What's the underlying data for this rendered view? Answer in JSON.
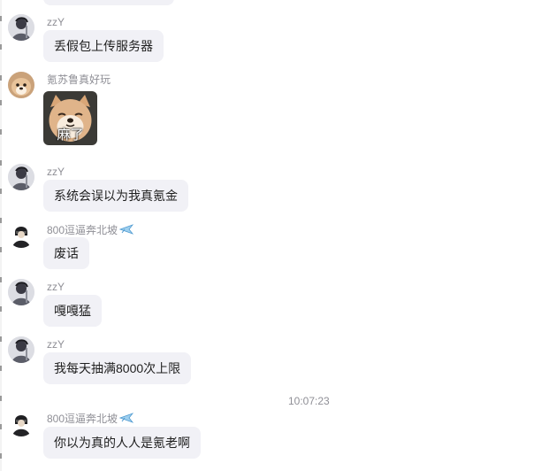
{
  "chat": {
    "messages": [
      {
        "id": "m1",
        "sender": "zzY",
        "avatar": "ink-painting-avatar",
        "text": "丢假包上传服务器"
      },
      {
        "id": "m2",
        "sender": "氪苏鲁真好玩",
        "avatar": "dog-avatar",
        "sticker": {
          "caption": "麻了",
          "icon": "shiba-dog-sticker"
        }
      },
      {
        "id": "m3",
        "sender": "zzY",
        "avatar": "ink-painting-avatar",
        "text": "系统会误以为我真氪金"
      },
      {
        "id": "m4",
        "sender": "800逗逼奔北坡",
        "sender_icon": "airplane-icon",
        "avatar": "dark-figure-avatar",
        "text": "废话"
      },
      {
        "id": "m5",
        "sender": "zzY",
        "avatar": "ink-painting-avatar",
        "text": "嘎嘎猛"
      },
      {
        "id": "m6",
        "sender": "zzY",
        "avatar": "ink-painting-avatar",
        "text": "我每天抽满8000次上限"
      },
      {
        "id": "m7",
        "sender": "800逗逼奔北坡",
        "sender_icon": "airplane-icon",
        "avatar": "dark-figure-avatar",
        "text": "你以为真的人人是氪老啊"
      }
    ],
    "timestamps": [
      "10:07:23"
    ]
  },
  "colors": {
    "bubble_bg": "#f1f1f6",
    "text": "#1f1f1f",
    "meta_text": "#8f8f96",
    "background": "#ffffff"
  }
}
